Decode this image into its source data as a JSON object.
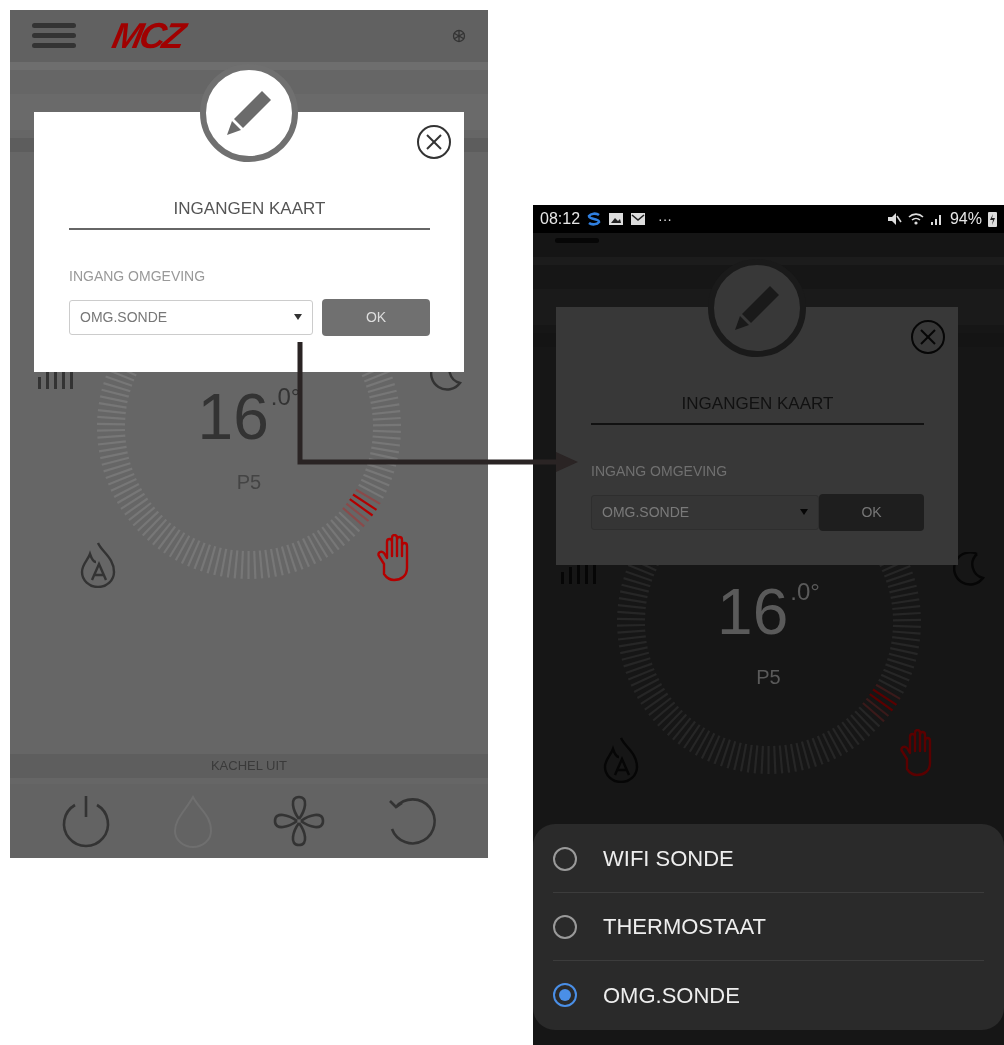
{
  "left_screen": {
    "logo": "MCZ",
    "dialog": {
      "title": "INGANGEN KAART",
      "field_label": "INGANG OMGEVING",
      "select_value": "OMG.SONDE",
      "ok_button": "OK"
    },
    "temperature": "16",
    "temperature_decimal": ".0°",
    "power_level": "P5",
    "status_text": "KACHEL UIT"
  },
  "right_screen": {
    "status_bar": {
      "time": "08:12",
      "more": "···",
      "battery": "94%"
    },
    "dialog": {
      "title": "INGANGEN KAART",
      "field_label": "INGANG OMGEVING",
      "select_value": "OMG.SONDE",
      "ok_button": "OK"
    },
    "temperature": "16",
    "temperature_decimal": ".0°",
    "power_level": "P5",
    "options": [
      {
        "label": "WIFI SONDE",
        "selected": false
      },
      {
        "label": "THERMOSTAAT",
        "selected": false
      },
      {
        "label": "OMG.SONDE",
        "selected": true
      }
    ]
  }
}
